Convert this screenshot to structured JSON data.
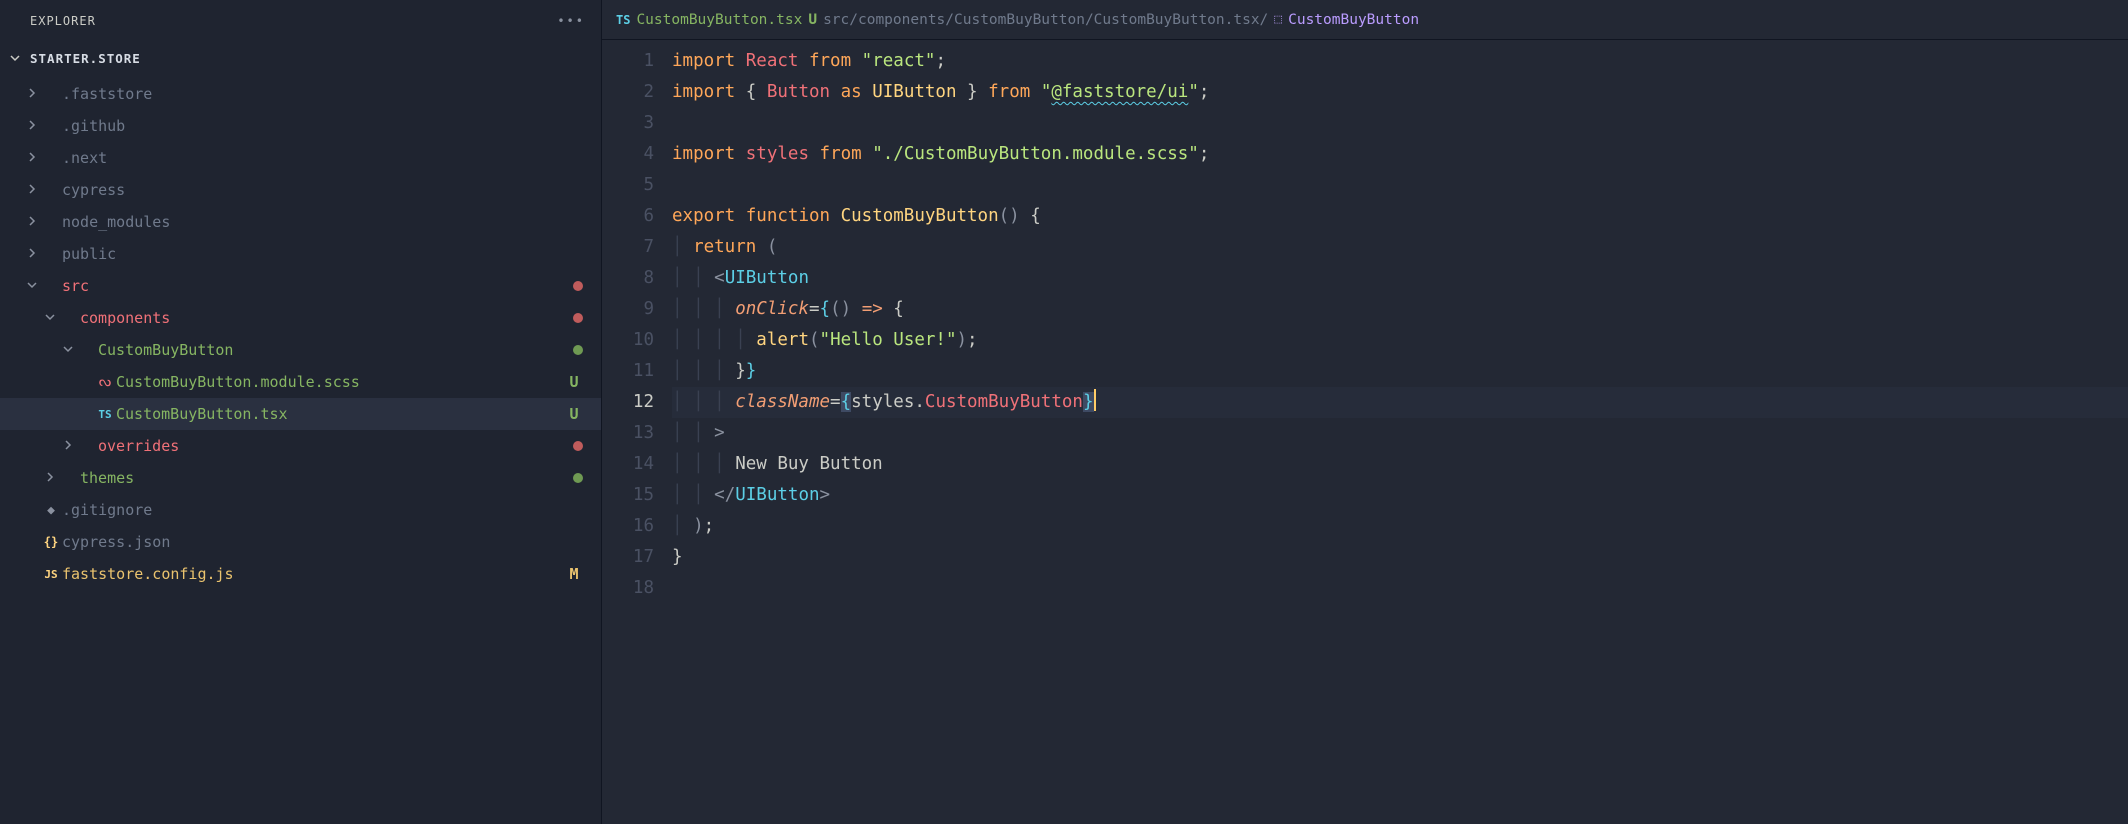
{
  "sidebar": {
    "title": "EXPLORER",
    "project": "STARTER.STORE",
    "tree": [
      {
        "depth": 0,
        "chev": "right",
        "icon": "",
        "label": ".faststore",
        "color": "c-muted"
      },
      {
        "depth": 0,
        "chev": "right",
        "icon": "",
        "label": ".github",
        "color": "c-muted"
      },
      {
        "depth": 0,
        "chev": "right",
        "icon": "",
        "label": ".next",
        "color": "c-muted"
      },
      {
        "depth": 0,
        "chev": "right",
        "icon": "",
        "label": "cypress",
        "color": "c-muted"
      },
      {
        "depth": 0,
        "chev": "right",
        "icon": "",
        "label": "node_modules",
        "color": "c-muted"
      },
      {
        "depth": 0,
        "chev": "right",
        "icon": "",
        "label": "public",
        "color": "c-muted"
      },
      {
        "depth": 0,
        "chev": "down",
        "icon": "",
        "label": "src",
        "color": "c-red",
        "dot": "dot-red"
      },
      {
        "depth": 1,
        "chev": "down",
        "icon": "",
        "label": "components",
        "color": "c-red",
        "dot": "dot-red"
      },
      {
        "depth": 2,
        "chev": "down",
        "icon": "",
        "label": "CustomBuyButton",
        "color": "c-green",
        "dot": "dot-green"
      },
      {
        "depth": 3,
        "chev": "",
        "icon": "scss",
        "label": "CustomBuyButton.module.scss",
        "color": "c-green",
        "status": "U",
        "statusColor": "c-green"
      },
      {
        "depth": 3,
        "chev": "",
        "icon": "ts",
        "label": "CustomBuyButton.tsx",
        "color": "c-green",
        "status": "U",
        "statusColor": "c-green",
        "selected": true
      },
      {
        "depth": 2,
        "chev": "right",
        "icon": "",
        "label": "overrides",
        "color": "c-red",
        "dot": "dot-red"
      },
      {
        "depth": 1,
        "chev": "right",
        "icon": "",
        "label": "themes",
        "color": "c-green",
        "dot": "dot-green"
      },
      {
        "depth": 0,
        "chev": "",
        "icon": "git",
        "label": ".gitignore",
        "color": "c-muted"
      },
      {
        "depth": 0,
        "chev": "",
        "icon": "json",
        "label": "cypress.json",
        "color": "c-muted"
      },
      {
        "depth": 0,
        "chev": "",
        "icon": "js",
        "label": "faststore.config.js",
        "color": "c-goldM",
        "status": "M",
        "statusColor": "c-goldM"
      }
    ]
  },
  "breadcrumb": {
    "icon": "TS",
    "filename": "CustomBuyButton.tsx",
    "badge": "U",
    "path": "src/components/CustomBuyButton/CustomBuyButton.tsx/",
    "symbol": "CustomBuyButton"
  },
  "code": {
    "currentLine": 12,
    "lines": [
      [
        {
          "t": "import ",
          "c": "tk-orange"
        },
        {
          "t": "React ",
          "c": "tk-red"
        },
        {
          "t": "from ",
          "c": "tk-orange"
        },
        {
          "t": "\"react\"",
          "c": "tk-string"
        },
        {
          "t": ";",
          "c": "tk-punc"
        }
      ],
      [
        {
          "t": "import ",
          "c": "tk-orange"
        },
        {
          "t": "{ ",
          "c": "tk-punc"
        },
        {
          "t": "Button ",
          "c": "tk-red"
        },
        {
          "t": "as ",
          "c": "tk-orange"
        },
        {
          "t": "UIButton ",
          "c": "tk-yellow"
        },
        {
          "t": "} ",
          "c": "tk-punc"
        },
        {
          "t": "from ",
          "c": "tk-orange"
        },
        {
          "t": "\"",
          "c": "tk-string"
        },
        {
          "t": "@faststore/ui",
          "c": "tk-string tk-under"
        },
        {
          "t": "\"",
          "c": "tk-string"
        },
        {
          "t": ";",
          "c": "tk-punc"
        }
      ],
      [],
      [
        {
          "t": "import ",
          "c": "tk-orange"
        },
        {
          "t": "styles ",
          "c": "tk-red"
        },
        {
          "t": "from ",
          "c": "tk-orange"
        },
        {
          "t": "\"./CustomBuyButton.module.scss\"",
          "c": "tk-string"
        },
        {
          "t": ";",
          "c": "tk-punc"
        }
      ],
      [],
      [
        {
          "t": "export ",
          "c": "tk-orange"
        },
        {
          "t": "function ",
          "c": "tk-func"
        },
        {
          "t": "CustomBuyButton",
          "c": "tk-yellow"
        },
        {
          "t": "()",
          "c": "tk-paren"
        },
        {
          "t": " {",
          "c": "tk-punc"
        }
      ],
      [
        {
          "t": "│ ",
          "c": "guide"
        },
        {
          "t": "return ",
          "c": "tk-orange"
        },
        {
          "t": "(",
          "c": "tk-paren"
        }
      ],
      [
        {
          "t": "│ │ ",
          "c": "guide"
        },
        {
          "t": "<",
          "c": "tk-paren"
        },
        {
          "t": "UIButton",
          "c": "tk-cyan"
        }
      ],
      [
        {
          "t": "│ │ │ ",
          "c": "guide"
        },
        {
          "t": "onClick",
          "c": "tk-attr"
        },
        {
          "t": "=",
          "c": "tk-punc"
        },
        {
          "t": "{",
          "c": "tk-cyan"
        },
        {
          "t": "() ",
          "c": "tk-paren"
        },
        {
          "t": "=>",
          "c": "tk-arrow"
        },
        {
          "t": " {",
          "c": "tk-punc"
        }
      ],
      [
        {
          "t": "│ │ │ │ ",
          "c": "guide"
        },
        {
          "t": "alert",
          "c": "tk-yellow"
        },
        {
          "t": "(",
          "c": "tk-paren"
        },
        {
          "t": "\"Hello User!\"",
          "c": "tk-string"
        },
        {
          "t": ")",
          "c": "tk-paren"
        },
        {
          "t": ";",
          "c": "tk-punc"
        }
      ],
      [
        {
          "t": "│ │ │ ",
          "c": "guide"
        },
        {
          "t": "}",
          "c": "tk-punc"
        },
        {
          "t": "}",
          "c": "tk-cyan"
        }
      ],
      [
        {
          "t": "│ │ │ ",
          "c": "guide"
        },
        {
          "t": "className",
          "c": "tk-attr"
        },
        {
          "t": "=",
          "c": "tk-punc"
        },
        {
          "t": "{",
          "c": "tk-cyan sel"
        },
        {
          "t": "styles",
          "c": "tk-styles"
        },
        {
          "t": ".",
          "c": "tk-punc"
        },
        {
          "t": "CustomBuyButton",
          "c": "tk-red"
        },
        {
          "t": "}",
          "c": "tk-cyan sel"
        },
        {
          "t": "",
          "c": "cursor"
        }
      ],
      [
        {
          "t": "│ │ ",
          "c": "guide"
        },
        {
          "t": ">",
          "c": "tk-paren"
        }
      ],
      [
        {
          "t": "│ │ │ ",
          "c": "guide"
        },
        {
          "t": "New Buy Button",
          "c": "tk-punc"
        }
      ],
      [
        {
          "t": "│ │ ",
          "c": "guide"
        },
        {
          "t": "</",
          "c": "tk-paren"
        },
        {
          "t": "UIButton",
          "c": "tk-cyan"
        },
        {
          "t": ">",
          "c": "tk-paren"
        }
      ],
      [
        {
          "t": "│ ",
          "c": "guide"
        },
        {
          "t": ")",
          "c": "tk-paren"
        },
        {
          "t": ";",
          "c": "tk-punc"
        }
      ],
      [
        {
          "t": "}",
          "c": "tk-punc"
        }
      ],
      []
    ]
  }
}
